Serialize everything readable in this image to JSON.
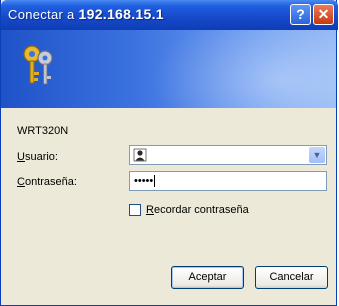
{
  "window": {
    "title_prefix": "Conectar a ",
    "title_host": "192.168.15.1",
    "help_label": "?",
    "close_label": "✕",
    "colors": {
      "title_bar": "#1648c9",
      "body": "#ece9d8",
      "banner": "#3b72e0"
    }
  },
  "banner": {
    "icon": "keys-icon"
  },
  "form": {
    "device_name": "WRT320N",
    "user_label_accel": "U",
    "user_label_rest": "suario:",
    "username_value": "",
    "user_icon": "user-icon",
    "pass_label_accel": "C",
    "pass_label_rest": "ontraseña:",
    "password_value": "•••••",
    "remember_accel": "R",
    "remember_rest": "ecordar contraseña",
    "remember_checked": false
  },
  "buttons": {
    "ok_label": "Aceptar",
    "cancel_label": "Cancelar"
  }
}
